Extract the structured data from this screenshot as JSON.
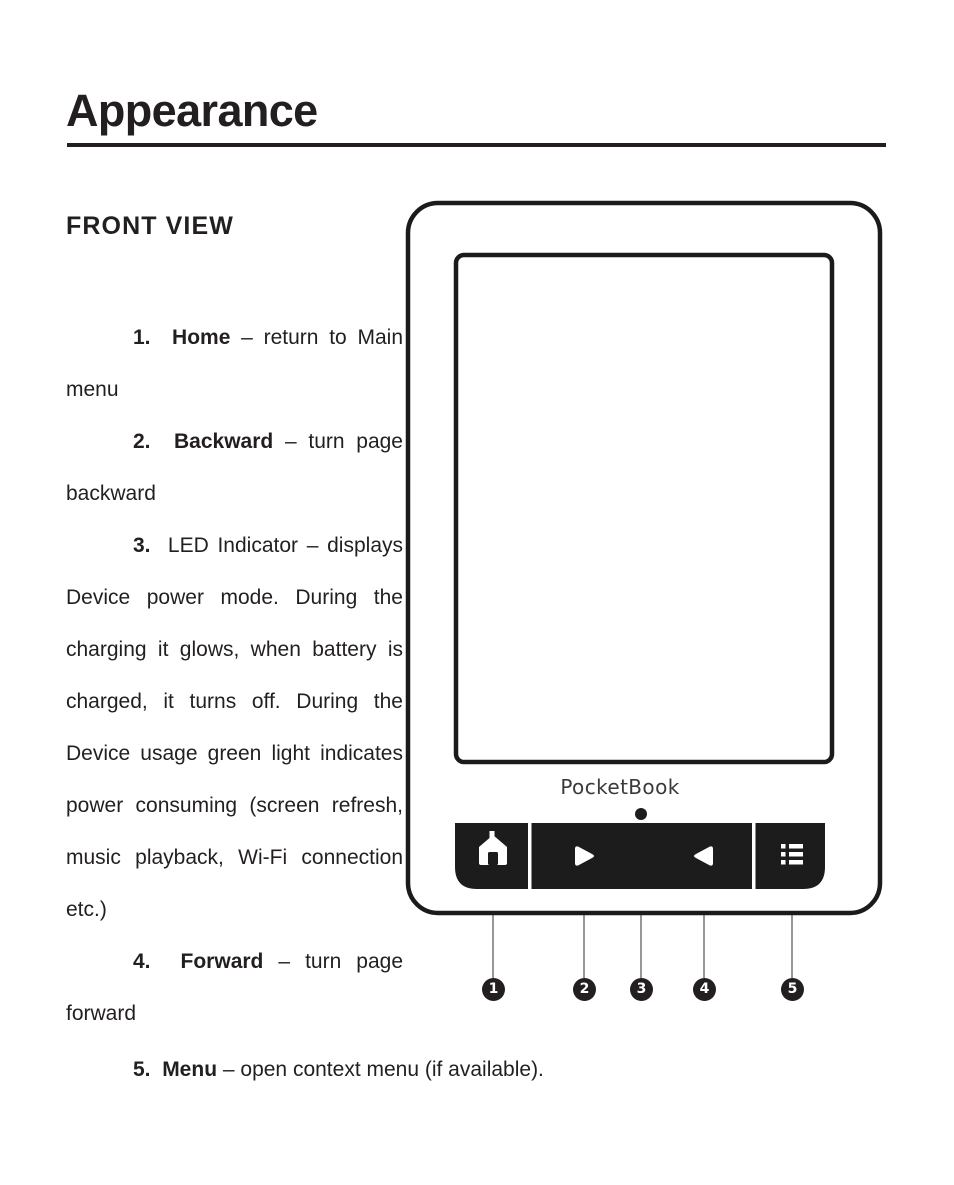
{
  "document": {
    "chapter_title": "Appearance",
    "section_title": "FRONT VIEW"
  },
  "items": [
    {
      "number": "1.",
      "term": "Home",
      "dash": "–",
      "description": "return to Main menu",
      "term_bold": true
    },
    {
      "number": "2.",
      "term": "Backward",
      "dash": "–",
      "description": "turn page backward",
      "term_bold": true
    },
    {
      "number": "3.",
      "term": "LED Indicator",
      "dash": "–",
      "description": "displays Device power mode. During the charging it glows, when battery is charged, it turns off. During the Device usage green light indicates power consuming (screen refresh, music playback, Wi-Fi connection etc.)",
      "term_bold": false
    },
    {
      "number": "4.",
      "term": "Forward",
      "dash": "–",
      "description": "turn page forward",
      "term_bold": true
    },
    {
      "number": "5.",
      "term": "Menu",
      "dash": "–",
      "description": "open context menu (if available).",
      "term_bold": true
    }
  ],
  "figure": {
    "brand_logo": "PocketBook",
    "buttons": [
      {
        "name": "home-button",
        "icon": "home-icon",
        "label": "Home"
      },
      {
        "name": "backward-button",
        "icon": "triangle-left-icon",
        "label": "Backward"
      },
      {
        "name": "forward-button",
        "icon": "triangle-right-icon",
        "label": "Forward"
      },
      {
        "name": "menu-button",
        "icon": "list-menu-icon",
        "label": "Menu"
      }
    ],
    "led_indicator": {
      "name": "led-indicator-dot",
      "label": "LED Indicator"
    },
    "callouts": [
      {
        "label": "1",
        "target": "home-button"
      },
      {
        "label": "2",
        "target": "backward-button"
      },
      {
        "label": "3",
        "target": "led-indicator-dot"
      },
      {
        "label": "4",
        "target": "forward-button"
      },
      {
        "label": "5",
        "target": "menu-button"
      }
    ]
  },
  "colors": {
    "ink": "#231f20",
    "device_body": "#1c1c1c",
    "leader_line": "#7d7d7d",
    "page_background": "#ffffff"
  }
}
